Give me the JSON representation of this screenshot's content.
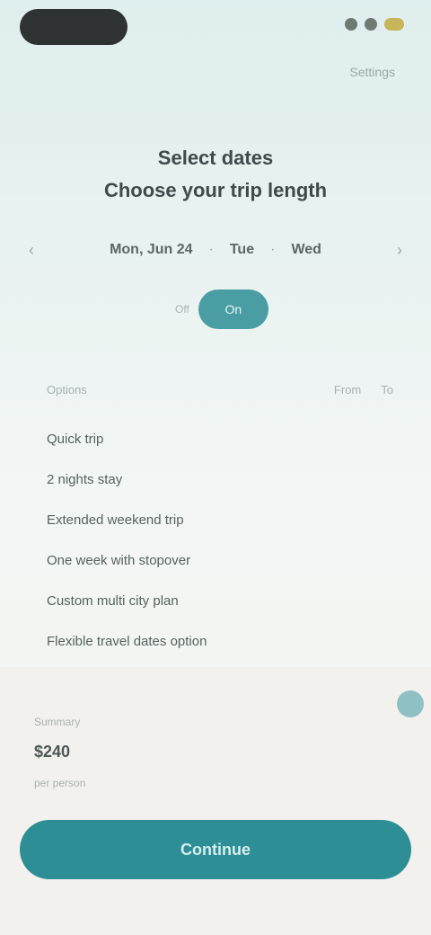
{
  "status_bar": {
    "time_label": "",
    "icons": [
      "signal-icon",
      "battery-icon"
    ]
  },
  "header": {
    "top_link": "Settings"
  },
  "title": {
    "line1": "Select dates",
    "line2": "Choose your trip length"
  },
  "date_nav": {
    "prev": "‹",
    "range_start": "Mon, Jun 24",
    "range_mid": "Tue",
    "range_end": "Wed",
    "next": "›"
  },
  "mode_toggle": {
    "off_label": "Off",
    "on_label": "On"
  },
  "list_header": {
    "left": "Options",
    "mid": "From",
    "right": "To"
  },
  "list_items": [
    "Quick trip",
    "2 nights stay",
    "Extended weekend trip",
    "One week with stopover",
    "Custom multi city plan",
    "Flexible travel dates option"
  ],
  "card": {
    "small": "Summary",
    "value": "$240",
    "sub": "per person"
  },
  "primary_button": {
    "label": "Continue"
  },
  "colors": {
    "accent": "#2e8e95",
    "pill": "#4a9ea3"
  }
}
